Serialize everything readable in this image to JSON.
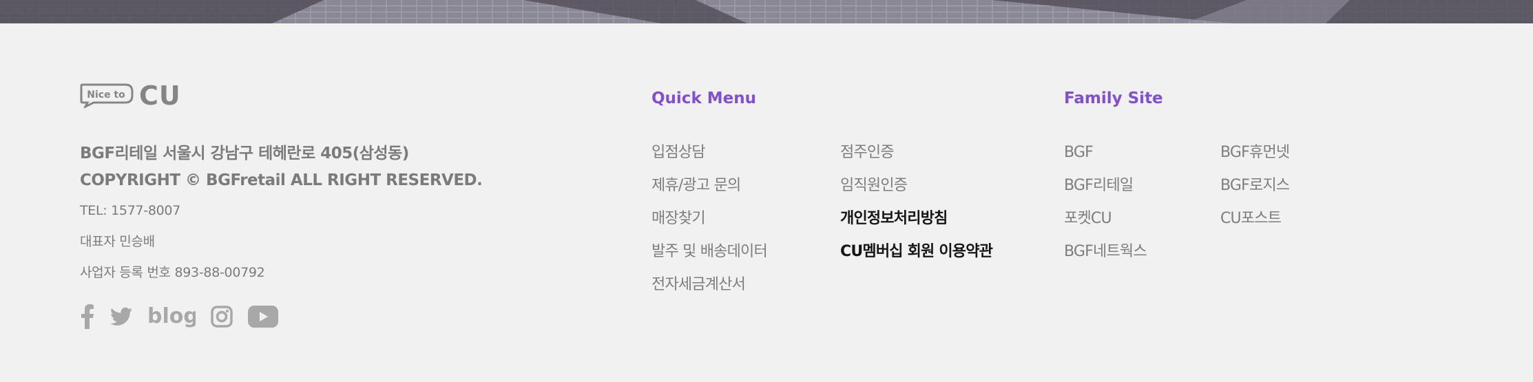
{
  "brand": {
    "bubble_text": "Nice to",
    "logo_text": "CU",
    "logo_color": "#858585"
  },
  "company": {
    "address": "BGF리테일 서울시 강남구 테헤란로 405(삼성동)",
    "copyright": "COPYRIGHT © BGFretail ALL RIGHT RESERVED.",
    "tel": "TEL: 1577-8007",
    "ceo": "대표자 민승배",
    "business_no": "사업자 등록 번호 893-88-00792"
  },
  "social": [
    {
      "name": "facebook-icon"
    },
    {
      "name": "twitter-icon"
    },
    {
      "name": "blog-icon",
      "text": "blog"
    },
    {
      "name": "instagram-icon"
    },
    {
      "name": "youtube-icon"
    }
  ],
  "quick_menu": {
    "title": "Quick Menu",
    "col1": [
      "입점상담",
      "제휴/광고 문의",
      "매장찾기",
      "발주 및 배송데이터",
      "전자세금계산서"
    ],
    "col2": [
      "점주인증",
      "임직원인증",
      "개인정보처리방침",
      "CU멤버십 회원 이용약관"
    ]
  },
  "family_site": {
    "title": "Family Site",
    "col1": [
      "BGF",
      "BGF리테일",
      "포켓CU",
      "BGF네트웍스"
    ],
    "col2": [
      "BGF휴먼넷",
      "BGF로지스",
      "CU포스트"
    ]
  },
  "colors": {
    "accent": "#7f4fd6",
    "text_muted": "#7d7d7d",
    "text_strong": "#151515",
    "background": "#f1f1f1"
  }
}
